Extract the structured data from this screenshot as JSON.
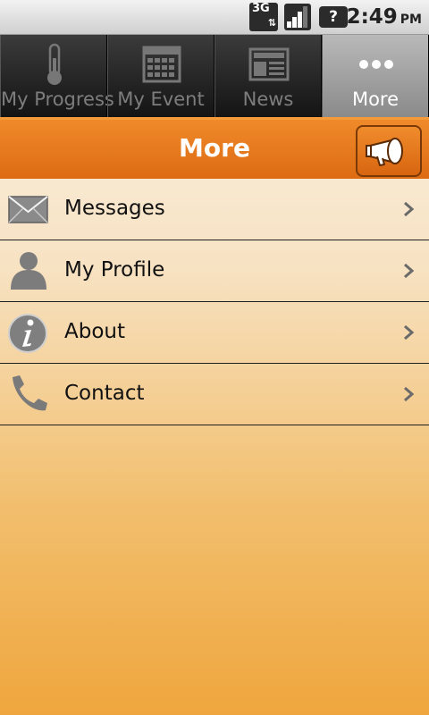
{
  "status_bar": {
    "network_label": "3G",
    "time": "2:49",
    "ampm": "PM",
    "icons": [
      "network-3g-icon",
      "signal-icon",
      "battery-unknown-icon"
    ],
    "battery_label": "?"
  },
  "tabs": [
    {
      "label": "My Progress",
      "icon": "thermometer-icon",
      "active": false
    },
    {
      "label": "My Event",
      "icon": "calendar-icon",
      "active": false
    },
    {
      "label": "News",
      "icon": "newspaper-icon",
      "active": false
    },
    {
      "label": "More",
      "icon": "more-dots-icon",
      "active": true
    }
  ],
  "header": {
    "title": "More",
    "action_icon": "megaphone-icon"
  },
  "menu": [
    {
      "label": "Messages",
      "icon": "envelope-icon"
    },
    {
      "label": "My Profile",
      "icon": "person-icon"
    },
    {
      "label": "About",
      "icon": "info-icon"
    },
    {
      "label": "Contact",
      "icon": "phone-icon"
    }
  ],
  "colors": {
    "accent": "#E57A1E",
    "tab_active": "#A0A0A0",
    "background_bottom": "#EFA63D"
  }
}
